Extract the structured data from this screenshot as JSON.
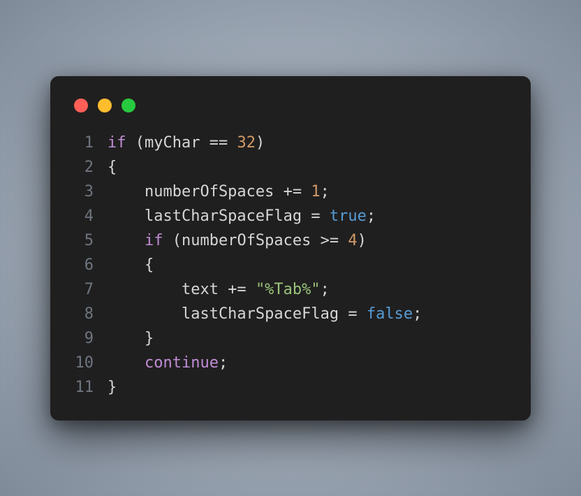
{
  "window": {
    "dots": [
      "red",
      "yellow",
      "green"
    ]
  },
  "code": {
    "lines": [
      {
        "n": "1",
        "tokens": [
          {
            "cls": "tok-keyword",
            "t": "if"
          },
          {
            "cls": "tok-default",
            "t": " (myChar "
          },
          {
            "cls": "tok-operator",
            "t": "=="
          },
          {
            "cls": "tok-default",
            "t": " "
          },
          {
            "cls": "tok-number",
            "t": "32"
          },
          {
            "cls": "tok-default",
            "t": ")"
          }
        ]
      },
      {
        "n": "2",
        "tokens": [
          {
            "cls": "tok-default",
            "t": "{"
          }
        ]
      },
      {
        "n": "3",
        "tokens": [
          {
            "cls": "tok-default",
            "t": "    numberOfSpaces "
          },
          {
            "cls": "tok-operator",
            "t": "+="
          },
          {
            "cls": "tok-default",
            "t": " "
          },
          {
            "cls": "tok-number",
            "t": "1"
          },
          {
            "cls": "tok-default",
            "t": ";"
          }
        ]
      },
      {
        "n": "4",
        "tokens": [
          {
            "cls": "tok-default",
            "t": "    lastCharSpaceFlag "
          },
          {
            "cls": "tok-operator",
            "t": "="
          },
          {
            "cls": "tok-default",
            "t": " "
          },
          {
            "cls": "tok-bool",
            "t": "true"
          },
          {
            "cls": "tok-default",
            "t": ";"
          }
        ]
      },
      {
        "n": "5",
        "tokens": [
          {
            "cls": "tok-default",
            "t": "    "
          },
          {
            "cls": "tok-keyword",
            "t": "if"
          },
          {
            "cls": "tok-default",
            "t": " (numberOfSpaces "
          },
          {
            "cls": "tok-operator",
            "t": ">="
          },
          {
            "cls": "tok-default",
            "t": " "
          },
          {
            "cls": "tok-number",
            "t": "4"
          },
          {
            "cls": "tok-default",
            "t": ")"
          }
        ]
      },
      {
        "n": "6",
        "tokens": [
          {
            "cls": "tok-default",
            "t": "    {"
          }
        ]
      },
      {
        "n": "7",
        "tokens": [
          {
            "cls": "tok-default",
            "t": "        text "
          },
          {
            "cls": "tok-operator",
            "t": "+="
          },
          {
            "cls": "tok-default",
            "t": " "
          },
          {
            "cls": "tok-string",
            "t": "\"%Tab%\""
          },
          {
            "cls": "tok-default",
            "t": ";"
          }
        ]
      },
      {
        "n": "8",
        "tokens": [
          {
            "cls": "tok-default",
            "t": "        lastCharSpaceFlag "
          },
          {
            "cls": "tok-operator",
            "t": "="
          },
          {
            "cls": "tok-default",
            "t": " "
          },
          {
            "cls": "tok-bool",
            "t": "false"
          },
          {
            "cls": "tok-default",
            "t": ";"
          }
        ]
      },
      {
        "n": "9",
        "tokens": [
          {
            "cls": "tok-default",
            "t": "    }"
          }
        ]
      },
      {
        "n": "10",
        "tokens": [
          {
            "cls": "tok-default",
            "t": "    "
          },
          {
            "cls": "tok-keyword",
            "t": "continue"
          },
          {
            "cls": "tok-default",
            "t": ";"
          }
        ]
      },
      {
        "n": "11",
        "tokens": [
          {
            "cls": "tok-default",
            "t": "}"
          }
        ]
      }
    ]
  }
}
